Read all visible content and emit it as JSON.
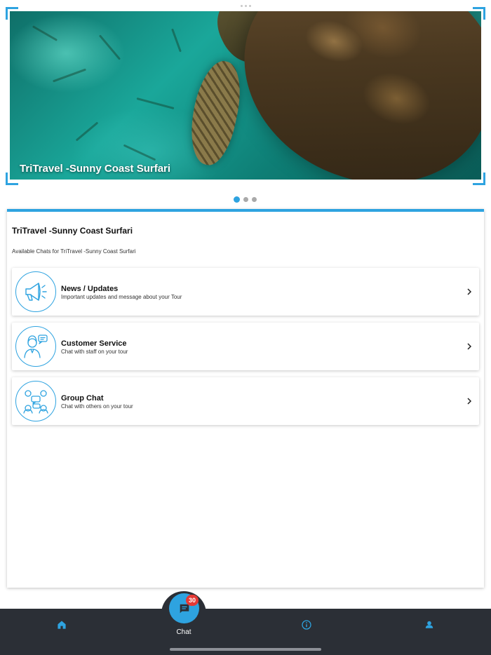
{
  "hero": {
    "caption": "TriTravel -Sunny Coast Surfari"
  },
  "pager": {
    "total": 3,
    "active_index": 0
  },
  "card": {
    "title": "TriTravel -Sunny Coast Surfari",
    "subtitle": "Available Chats for TriTravel -Sunny Coast Surfari",
    "chats": [
      {
        "name": "News / Updates",
        "description": "Important updates and message about your Tour",
        "icon": "megaphone-icon"
      },
      {
        "name": "Customer Service",
        "description": "Chat with staff on your tour",
        "icon": "support-agent-icon"
      },
      {
        "name": "Group Chat",
        "description": "Chat with others on your tour",
        "icon": "group-chat-icon"
      }
    ]
  },
  "nav": {
    "chat_label": "Chat",
    "chat_badge": "30",
    "items": [
      "home-icon",
      "chat-icon",
      "info-icon",
      "profile-icon"
    ]
  },
  "colors": {
    "accent": "#2ea3e0",
    "navbar": "#2b2f36",
    "badge": "#e53935"
  }
}
